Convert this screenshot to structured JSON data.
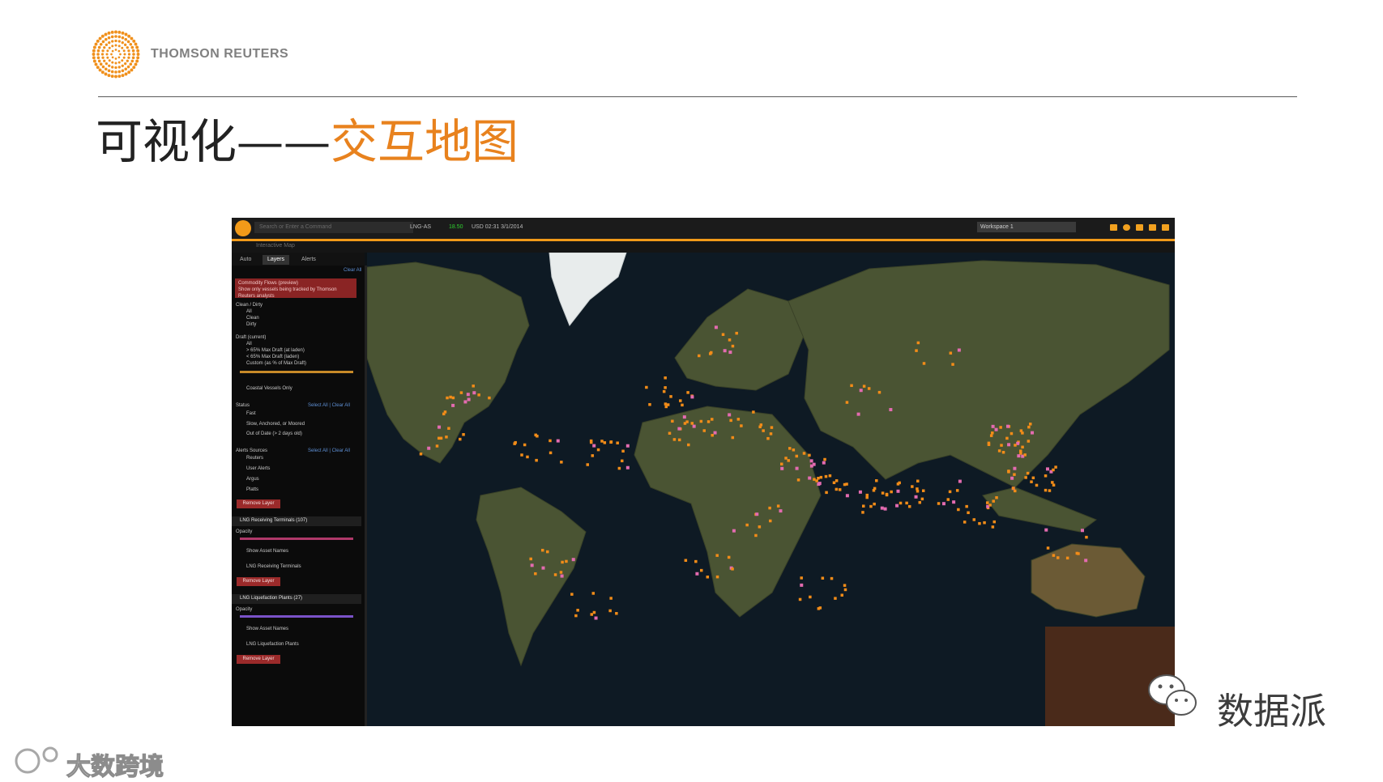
{
  "slide": {
    "brand": "THOMSON REUTERS",
    "title_prefix": "可视化——",
    "title_accent": "交互地图",
    "brand_color": "#f29a19",
    "accent_color": "#e8821e"
  },
  "app": {
    "command_placeholder": "Search or Enter a Command",
    "ticker_symbol": "LNG-AS",
    "ticker_value": "18.50",
    "ticker_time": "USD 02:31 3/1/2014",
    "workspace": "Workspace 1",
    "window_title": "Interactive Map",
    "tabs": [
      {
        "label": "Auto",
        "active": false
      },
      {
        "label": "Layers",
        "active": true
      },
      {
        "label": "Alerts",
        "active": false
      }
    ]
  },
  "panel": {
    "clear_all": "Clear All",
    "commodity_flows": "Commodity Flows (preview)",
    "tracked_note": "Show only vessels being tracked by Thomson Reuters analysts",
    "clean_dirty": "Clean / Dirty",
    "clean_options": [
      "All",
      "Clean",
      "Dirty"
    ],
    "draft_label": "Draft (current)",
    "draft_options": [
      "All",
      "> 65% Max Draft (at laden)",
      "< 65% Max Draft (laden)",
      "Custom (as % of Max Draft)"
    ],
    "coastal": "Coastal Vessels Only",
    "status_label": "Status",
    "select_all_clear_all": "Select All | Clear All",
    "status_options": [
      "Fast",
      "Slow, Anchored, or Moored",
      "Out of Date (> 2 days old)"
    ],
    "alerts_sources": "Alerts Sources",
    "alert_options": [
      "Reuters",
      "User Alerts",
      "Argus",
      "Platts"
    ],
    "remove_layer": "Remove Layer",
    "layer1_title": "LNG Receiving Terminals (107)",
    "layer1_item": "LNG Receiving Terminals",
    "layer2_title": "LNG Liquefaction Plants (27)",
    "layer2_item": "LNG Liquefaction Plants",
    "opacity": "Opacity",
    "show_asset_names": "Show Asset Names"
  },
  "wechat": {
    "name": "数据派"
  },
  "watermark": {
    "text": "大数跨境"
  }
}
